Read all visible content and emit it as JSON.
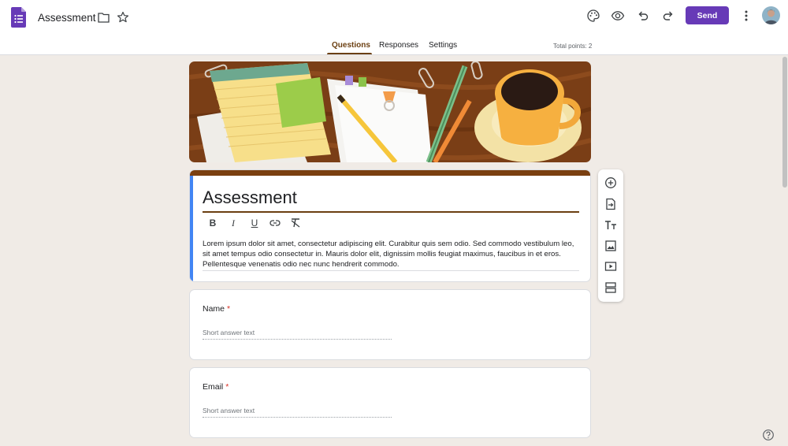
{
  "app": {
    "title": "Assessment",
    "send_label": "Send"
  },
  "tabs": [
    {
      "label": "Questions",
      "active": true
    },
    {
      "label": "Responses",
      "active": false
    },
    {
      "label": "Settings",
      "active": false
    }
  ],
  "total_points": "Total points: 2",
  "form": {
    "title": "Assessment",
    "description": "Lorem ipsum dolor sit amet, consectetur adipiscing elit. Curabitur quis sem odio. Sed commodo vestibulum leo, sit amet tempus odio consectetur in. Mauris dolor elit, dignissim mollis feugiat maximus, faucibus in et eros. Pellentesque venenatis odio nec nunc hendrerit commodo."
  },
  "format_buttons": [
    {
      "label": "B",
      "name": "bold-button"
    },
    {
      "label": "I",
      "name": "italic-button"
    },
    {
      "label": "U",
      "name": "underline-button"
    }
  ],
  "questions": [
    {
      "label": "Name",
      "required_mark": "*",
      "placeholder": "Short answer text"
    },
    {
      "label": "Email",
      "required_mark": "*",
      "placeholder": "Short answer text"
    }
  ],
  "colors": {
    "accent": "#673ab7",
    "theme": "#6b3f11",
    "title_left_border": "#4285f4",
    "required": "#d93025",
    "background": "#f0ebe6"
  },
  "icons": {
    "topbar": [
      "forms-logo-icon",
      "folder-icon",
      "star-icon",
      "palette-icon",
      "preview-eye-icon",
      "undo-icon",
      "redo-icon",
      "more-vert-icon"
    ],
    "side_toolbar": [
      "add-question-icon",
      "import-questions-icon",
      "add-title-icon",
      "add-image-icon",
      "add-video-icon",
      "add-section-icon"
    ],
    "format": [
      "link-icon",
      "clear-formatting-icon"
    ],
    "other": [
      "help-icon"
    ]
  }
}
